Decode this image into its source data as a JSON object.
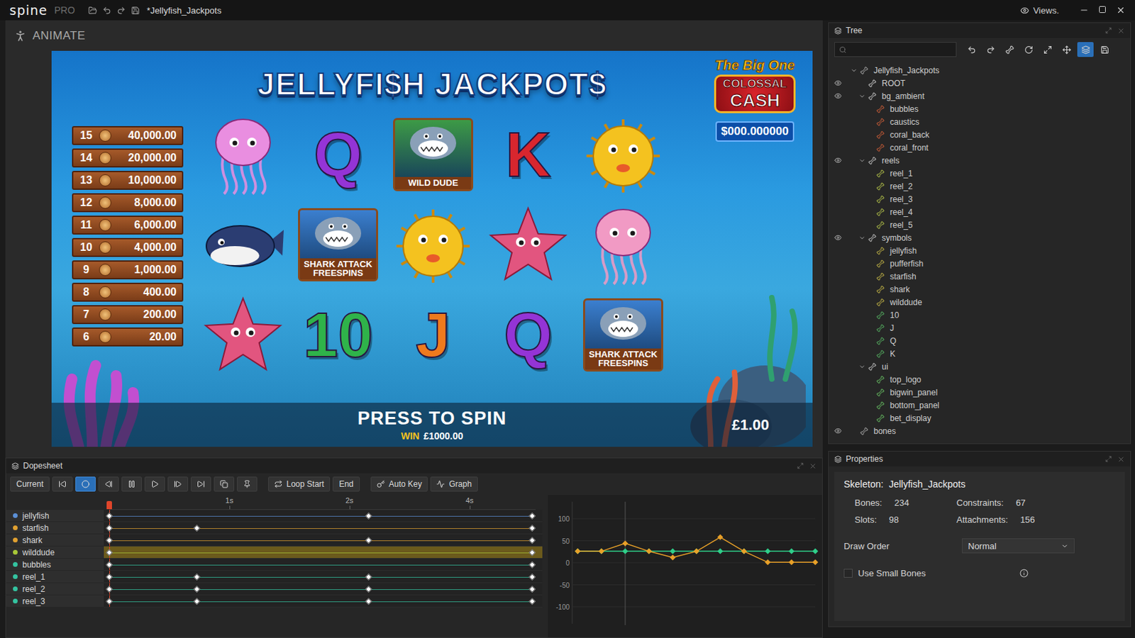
{
  "window": {
    "app_name": "spine",
    "app_edition": "PRO",
    "title": "*Jellyfish_Jackpots",
    "views": "Views."
  },
  "viewport": {
    "mode": "ANIMATE"
  },
  "game": {
    "title": "JELLYFI$H JACKPOT$",
    "jackpot": {
      "tagline": "The Big One",
      "line1": "COLOSSAL",
      "line2": "CASH",
      "amount": "$000.000000"
    },
    "paytable": [
      {
        "count": "15",
        "amount": "40,000.00"
      },
      {
        "count": "14",
        "amount": "20,000.00"
      },
      {
        "count": "13",
        "amount": "10,000.00"
      },
      {
        "count": "12",
        "amount": "8,000.00"
      },
      {
        "count": "11",
        "amount": "6,000.00"
      },
      {
        "count": "10",
        "amount": "4,000.00"
      },
      {
        "count": "9",
        "amount": "1,000.00"
      },
      {
        "count": "8",
        "amount": "400.00"
      },
      {
        "count": "7",
        "amount": "200.00"
      },
      {
        "count": "6",
        "amount": "20.00"
      }
    ],
    "reels": [
      [
        {
          "kind": "jellyfish",
          "color": "#e98ee0"
        },
        {
          "kind": "whale",
          "color": "#2b3d72"
        },
        {
          "kind": "starfish",
          "color": "#e2557f"
        }
      ],
      [
        {
          "kind": "letter",
          "label": "Q",
          "color": "#9434d6"
        },
        {
          "kind": "badge",
          "label": "SHARK ATTACK FREESPINS",
          "color": "#3b7fcf"
        },
        {
          "kind": "letter",
          "label": "10",
          "color": "#2fb34a"
        }
      ],
      [
        {
          "kind": "badge",
          "label": "WILD DUDE",
          "color": "#3d9a46"
        },
        {
          "kind": "pufferfish",
          "color": "#f4c21f"
        },
        {
          "kind": "letter",
          "label": "J",
          "color": "#ee7a1e"
        }
      ],
      [
        {
          "kind": "letter",
          "label": "K",
          "color": "#d8262e"
        },
        {
          "kind": "starfish",
          "color": "#e2557f"
        },
        {
          "kind": "letter",
          "label": "Q",
          "color": "#9434d6"
        }
      ],
      [
        {
          "kind": "pufferfish",
          "color": "#f4c21f"
        },
        {
          "kind": "jellyfish",
          "color": "#f19ac4"
        },
        {
          "kind": "badge",
          "label": "SHARK ATTACK FREESPINS",
          "color": "#3b7fcf"
        }
      ]
    ],
    "prompt": "PRESS TO SPIN",
    "win_label": "WIN",
    "win_amount": "£1000.00",
    "bet": "£1.00"
  },
  "tree": {
    "title": "Tree",
    "tools": [
      {
        "selected": false
      },
      {
        "selected": false
      },
      {
        "selected": false
      },
      {
        "selected": false
      },
      {
        "selected": false
      },
      {
        "selected": false
      },
      {
        "selected": true
      },
      {
        "selected": false
      }
    ],
    "items": [
      {
        "label": "Jellyfish_Jackpots",
        "depth": 0,
        "expandable": true,
        "expanded": true,
        "eye": false,
        "color": "#b8b8b8"
      },
      {
        "label": "ROOT",
        "depth": 1,
        "expandable": false,
        "expanded": false,
        "eye": true,
        "color": "#e6e6e6"
      },
      {
        "label": "bg_ambient",
        "depth": 1,
        "expandable": true,
        "expanded": true,
        "eye": true,
        "color": "#e0e0e0"
      },
      {
        "label": "bubbles",
        "depth": 2,
        "expandable": false,
        "expanded": false,
        "eye": false,
        "color": "#e2653a"
      },
      {
        "label": "caustics",
        "depth": 2,
        "expandable": false,
        "expanded": false,
        "eye": false,
        "color": "#e2653a"
      },
      {
        "label": "coral_back",
        "depth": 2,
        "expandable": false,
        "expanded": false,
        "eye": false,
        "color": "#e2653a"
      },
      {
        "label": "coral_front",
        "depth": 2,
        "expandable": false,
        "expanded": false,
        "eye": false,
        "color": "#e2653a"
      },
      {
        "label": "reels",
        "depth": 1,
        "expandable": true,
        "expanded": true,
        "eye": true,
        "color": "#e0e0e0"
      },
      {
        "label": "reel_1",
        "depth": 2,
        "expandable": false,
        "expanded": false,
        "eye": false,
        "color": "#c6d84e"
      },
      {
        "label": "reel_2",
        "depth": 2,
        "expandable": false,
        "expanded": false,
        "eye": false,
        "color": "#c6d84e"
      },
      {
        "label": "reel_3",
        "depth": 2,
        "expandable": false,
        "expanded": false,
        "eye": false,
        "color": "#c6d84e"
      },
      {
        "label": "reel_4",
        "depth": 2,
        "expandable": false,
        "expanded": false,
        "eye": false,
        "color": "#c6d84e"
      },
      {
        "label": "reel_5",
        "depth": 2,
        "expandable": false,
        "expanded": false,
        "eye": false,
        "color": "#c6d84e"
      },
      {
        "label": "symbols",
        "depth": 1,
        "expandable": true,
        "expanded": true,
        "eye": true,
        "color": "#e0e0e0"
      },
      {
        "label": "jellyfish",
        "depth": 2,
        "expandable": false,
        "expanded": false,
        "eye": false,
        "color": "#d8c84a"
      },
      {
        "label": "pufferfish",
        "depth": 2,
        "expandable": false,
        "expanded": false,
        "eye": false,
        "color": "#d8c84a"
      },
      {
        "label": "starfish",
        "depth": 2,
        "expandable": false,
        "expanded": false,
        "eye": false,
        "color": "#d8c84a"
      },
      {
        "label": "shark",
        "depth": 2,
        "expandable": false,
        "expanded": false,
        "eye": false,
        "color": "#d8c84a"
      },
      {
        "label": "wilddude",
        "depth": 2,
        "expandable": false,
        "expanded": false,
        "eye": false,
        "color": "#d8c84a"
      },
      {
        "label": "10",
        "depth": 2,
        "expandable": false,
        "expanded": false,
        "eye": false,
        "color": "#5cc46a"
      },
      {
        "label": "J",
        "depth": 2,
        "expandable": false,
        "expanded": false,
        "eye": false,
        "color": "#5cc46a"
      },
      {
        "label": "Q",
        "depth": 2,
        "expandable": false,
        "expanded": false,
        "eye": false,
        "color": "#5cc46a"
      },
      {
        "label": "K",
        "depth": 2,
        "expandable": false,
        "expanded": false,
        "eye": false,
        "color": "#5cc46a"
      },
      {
        "label": "ui",
        "depth": 1,
        "expandable": true,
        "expanded": true,
        "eye": false,
        "color": "#e0e0e0"
      },
      {
        "label": "top_logo",
        "depth": 2,
        "expandable": false,
        "expanded": false,
        "eye": false,
        "color": "#6ed06a"
      },
      {
        "label": "bigwin_panel",
        "depth": 2,
        "expandable": false,
        "expanded": false,
        "eye": false,
        "color": "#6ed06a"
      },
      {
        "label": "bottom_panel",
        "depth": 2,
        "expandable": false,
        "expanded": false,
        "eye": false,
        "color": "#6ed06a"
      },
      {
        "label": "bet_display",
        "depth": 2,
        "expandable": false,
        "expanded": false,
        "eye": false,
        "color": "#6ed06a"
      },
      {
        "label": "bones",
        "depth": 0,
        "expandable": false,
        "expanded": false,
        "eye": true,
        "color": "#b8b8b8"
      }
    ]
  },
  "properties": {
    "title": "Properties",
    "skeleton_label": "Skeleton:",
    "skeleton_name": "Jellyfish_Jackpots",
    "stats": [
      {
        "label": "Bones:",
        "value": "234"
      },
      {
        "label": "Constraints:",
        "value": "67"
      },
      {
        "label": "Slots:",
        "value": "98"
      },
      {
        "label": "Attachments:",
        "value": "156"
      }
    ],
    "draw_order": {
      "label": "Draw Order",
      "value": "Normal"
    },
    "small_bones": {
      "label": "Use Small Bones",
      "checked": false
    }
  },
  "dopesheet": {
    "title": "Dopesheet",
    "current": "Current",
    "icon_buttons": [
      {
        "selected": false
      },
      {
        "selected": true
      },
      {
        "selected": false
      },
      {
        "selected": false
      },
      {
        "selected": false
      },
      {
        "selected": false
      },
      {
        "selected": false
      },
      {
        "selected": false
      },
      {
        "selected": false
      }
    ],
    "loop_start": "Loop Start",
    "end": "End",
    "auto_key": "Auto Key",
    "graph": "Graph",
    "duration": 3.55,
    "playhead": 0,
    "ruler": [
      {
        "label": "1s",
        "time": 1
      },
      {
        "label": "2s",
        "time": 2
      },
      {
        "label": "4s",
        "time": 3
      }
    ],
    "tracks": [
      {
        "name": "jellyfish",
        "color": "#5b8fd6",
        "selected": false,
        "keys": [
          0,
          2.16,
          3.52
        ]
      },
      {
        "name": "starfish",
        "color": "#e0a030",
        "selected": false,
        "keys": [
          0,
          0.73,
          3.52
        ]
      },
      {
        "name": "shark",
        "color": "#e0a030",
        "selected": false,
        "keys": [
          0,
          2.16,
          3.52
        ]
      },
      {
        "name": "wilddude",
        "color": "#a8c838",
        "selected": true,
        "keys": [
          0,
          3.52
        ]
      },
      {
        "name": "bubbles",
        "color": "#34c3a0",
        "selected": false,
        "keys": [
          0,
          3.52
        ]
      },
      {
        "name": "reel_1",
        "color": "#34c3a0",
        "selected": false,
        "keys": [
          0,
          0.73,
          2.16,
          3.52
        ]
      },
      {
        "name": "reel_2",
        "color": "#34c3a0",
        "selected": false,
        "keys": [
          0,
          0.73,
          2.16,
          3.52
        ]
      },
      {
        "name": "reel_3",
        "color": "#34c3a0",
        "selected": false,
        "keys": [
          0,
          0.73,
          2.16,
          3.52
        ]
      }
    ],
    "graph_panel": {
      "y_ticks": [
        "100",
        "50",
        "0",
        "-50",
        "-100"
      ],
      "series": [
        {
          "color": "#2fcf8a",
          "values": [
            26,
            26,
            26,
            26,
            26,
            26,
            26,
            26,
            26,
            26,
            26
          ]
        },
        {
          "color": "#e8a028",
          "values": [
            26,
            26,
            44,
            26,
            12,
            26,
            58,
            26,
            1,
            1,
            1
          ]
        }
      ]
    }
  }
}
